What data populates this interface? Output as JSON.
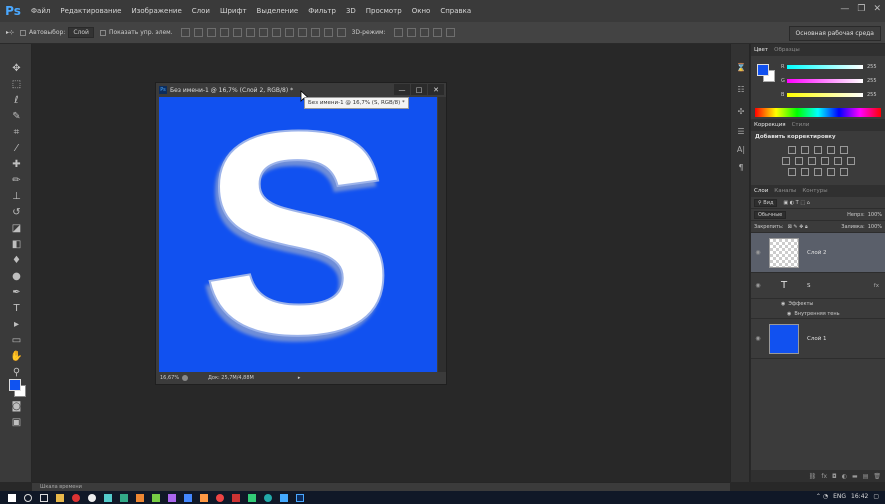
{
  "menu": {
    "logo": "Ps",
    "items": [
      "Файл",
      "Редактирование",
      "Изображение",
      "Слои",
      "Шрифт",
      "Выделение",
      "Фильтр",
      "3D",
      "Просмотр",
      "Окно",
      "Справка"
    ]
  },
  "options": {
    "autoselect_label": "Автовыбор:",
    "autoselect_value": "Слой",
    "show_transform": "Показать упр. элем.",
    "mode3d": "3D-режим:",
    "workspace": "Основная рабочая среда"
  },
  "document": {
    "title": "Без имени-1 @ 16,7% (Слой 2, RGB/8) *",
    "zoom": "16,67%",
    "doc_size": "Док: 25,7M/4,88M",
    "letter": "S"
  },
  "tooltip": {
    "text": "Без имени-1 @ 16,7% (S, RGB/8) *"
  },
  "color_panel": {
    "tabs": [
      "Цвет",
      "Образцы"
    ],
    "channels": [
      {
        "label": "R",
        "value": "255"
      },
      {
        "label": "G",
        "value": "255"
      },
      {
        "label": "B",
        "value": "255"
      }
    ]
  },
  "adjustments": {
    "tabs": [
      "Коррекция",
      "Стили"
    ],
    "title": "Добавить корректировку"
  },
  "layers": {
    "tabs": [
      "Слои",
      "Каналы",
      "Контуры"
    ],
    "kind": "Вид",
    "blend_mode": "Обычные",
    "opacity_label": "Непрз:",
    "opacity_value": "100%",
    "lock_label": "Закрепить:",
    "fill_label": "Заливка:",
    "fill_value": "100%",
    "items": [
      {
        "name": "Слой 2"
      },
      {
        "name": "S"
      },
      {
        "name": "Слой 1"
      }
    ],
    "effects_label": "Эффекты",
    "effect_inner": "Внутренняя тень",
    "fx": "fx"
  },
  "timeline": {
    "label": "Шкала времени"
  },
  "taskbar": {
    "lang": "ENG",
    "time": "16:42"
  },
  "colors": {
    "canvas_blue": "#1151f0",
    "ps_blue": "#4aa8ff"
  }
}
